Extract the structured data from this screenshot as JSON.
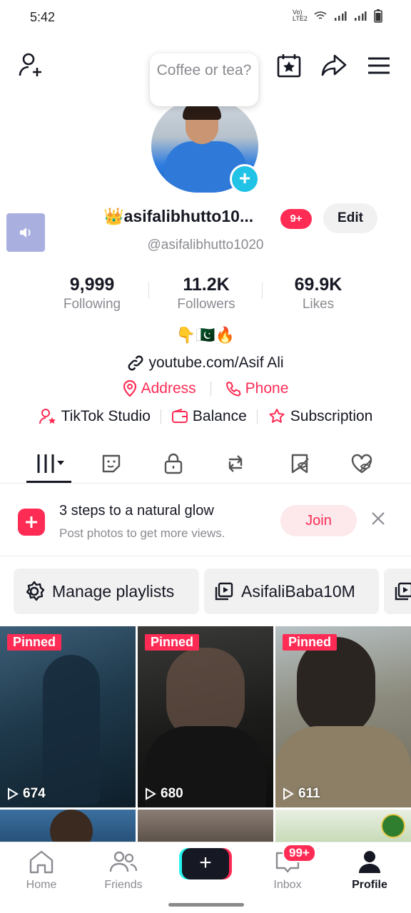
{
  "status": {
    "time": "5:42",
    "network": "Vo) LTE2"
  },
  "header": {
    "bubble": "Coffee or tea?"
  },
  "profile": {
    "username": "👑asifalibhutto10...",
    "notif_badge": "9+",
    "edit_label": "Edit",
    "handle": "@asifalibhutto1020"
  },
  "stats": [
    {
      "value": "9,999",
      "label": "Following"
    },
    {
      "value": "11.2K",
      "label": "Followers"
    },
    {
      "value": "69.9K",
      "label": "Likes"
    }
  ],
  "bio": {
    "emojis": "👇🇵🇰🔥",
    "link": "youtube.com/Asif Ali"
  },
  "contact": {
    "address": "Address",
    "phone": "Phone"
  },
  "tools": {
    "studio": "TikTok Studio",
    "balance": "Balance",
    "subscription": "Subscription"
  },
  "promo": {
    "title": "3 steps to a natural glow",
    "subtitle": "Post photos to get more views.",
    "join": "Join"
  },
  "playlists": {
    "manage": "Manage playlists",
    "item1": "AsifaliBaba10M"
  },
  "videos": [
    {
      "pinned": "Pinned",
      "views": "674"
    },
    {
      "pinned": "Pinned",
      "views": "680"
    },
    {
      "pinned": "Pinned",
      "views": "611"
    }
  ],
  "nav": {
    "home": "Home",
    "friends": "Friends",
    "inbox": "Inbox",
    "inbox_badge": "99+",
    "profile": "Profile"
  },
  "colors": {
    "accent": "#fe2c55",
    "muted": "#8a8b91",
    "text": "#161823"
  }
}
